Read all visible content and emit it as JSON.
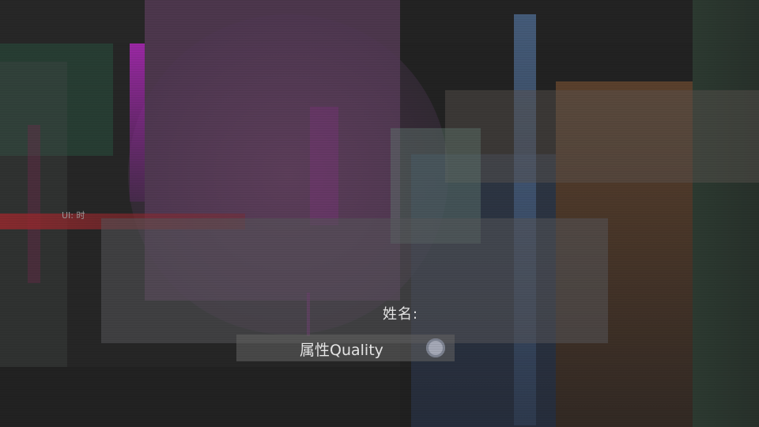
{
  "hud": {
    "ui_tag": "UI: 时"
  },
  "dialog": {
    "name_label": "姓名:"
  },
  "settings": {
    "quality_label": "属性Quality",
    "quality_toggle_icon": "radio-circle-icon"
  },
  "colors": {
    "magenta_accent": "#a028aa",
    "red_accent": "#962d2d",
    "blue_accent": "#506e96",
    "orange_accent": "#785032",
    "teal_accent": "#2d3c32"
  }
}
